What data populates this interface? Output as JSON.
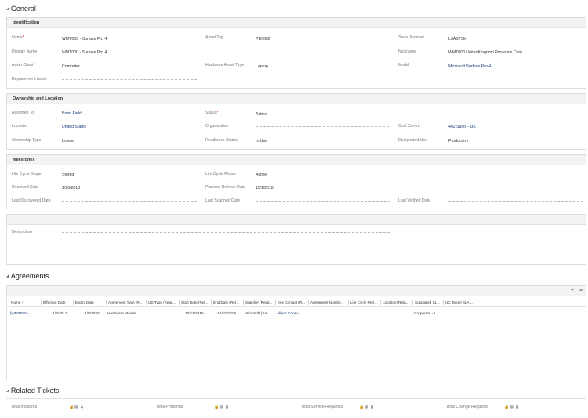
{
  "sections": {
    "general": "General",
    "agreements": "Agreements",
    "related_tickets": "Related Tickets"
  },
  "identification": {
    "title": "Identification",
    "name_label": "Name",
    "name_value": "WMT000 - Surface Pro 4",
    "display_name_label": "Display Name",
    "display_name_value": "WMT000 - Surface Pro 4",
    "asset_class_label": "Asset Class",
    "asset_class_value": "Computer",
    "replacement_asset_label": "Replacement Asset",
    "asset_tag_label": "Asset Tag",
    "asset_tag_value": "PD0602",
    "hardware_asset_type_label": "Hardware Asset Type",
    "hardware_asset_type_value": "Laptop",
    "serial_number_label": "Serial Number",
    "serial_number_value": "L3AB7SM",
    "nickname_label": "Nickname",
    "nickname_value": "WMT000.UnitedKingdom.Provance.Com",
    "model_label": "Model",
    "model_value": "Microsoft Surface Pro 4"
  },
  "ownership": {
    "title": "Ownership and Location",
    "assigned_to_label": "Assigned To",
    "assigned_to_value": "Brian Field",
    "location_label": "Location",
    "location_value": "United States",
    "ownership_type_label": "Ownership Type",
    "ownership_type_value": "Loaner",
    "status_label": "Status",
    "status_value": "Active",
    "organization_label": "Organization",
    "readiness_status_label": "Readiness Status",
    "readiness_status_value": "In Use",
    "cost_centre_label": "Cost Centre",
    "cost_centre_value": "402 Sales - UK",
    "designated_use_label": "Designated Use",
    "designated_use_value": "Production"
  },
  "milestones": {
    "title": "Milestones",
    "life_cycle_stage_label": "Life Cycle Stage",
    "life_cycle_stage_value": "Stored",
    "received_date_label": "Received Date",
    "received_date_value": "1/10/2013",
    "last_discovered_date_label": "Last Discovered Date",
    "life_cycle_phase_label": "Life Cycle Phase",
    "life_cycle_phase_value": "Active",
    "planned_refresh_date_label": "Planned Refresh Date",
    "planned_refresh_date_value": "11/1/2018",
    "last_scanned_date_label": "Last Scanned Date",
    "last_verified_date_label": "Last Verified Date"
  },
  "description": {
    "label": "Description"
  },
  "agreements": {
    "toolbar": {
      "add": "+",
      "view": "≡"
    },
    "columns": [
      "Name ↑",
      "Effective Date",
      "Expiry Date",
      "Agreement Type (R...",
      "UD Type (Relat...",
      "Start Date (Rel...",
      "End Date (Rel...",
      "Supplier (Relat...",
      "Key Contact (R...",
      "Agreement Numbe...",
      "Life Cycle (Rel...",
      "Location (Rela...",
      "Supported SL...",
      "UC Target SLA ..."
    ],
    "rows": [
      {
        "name": "[WMT000 - ...",
        "effective_date": "1/9/2017",
        "expiry_date": "1/8/2020",
        "agreement_type": "Hardware Mainte...",
        "start_date": "10/11/2016",
        "end_date": "10/10/2018",
        "supplier": "Microsoft (Sa...",
        "key_contact": "Albert Consu...",
        "supported_sla": "Corporate - I..."
      }
    ]
  },
  "tickets": {
    "incidents_label": "Total Incidents",
    "incidents_count": "4",
    "problems_label": "Total Problems",
    "problems_count": "0",
    "service_requests_label": "Total Service Requests",
    "service_requests_count": "0",
    "change_requests_label": "Total Change Requests",
    "change_requests_count": "0"
  }
}
